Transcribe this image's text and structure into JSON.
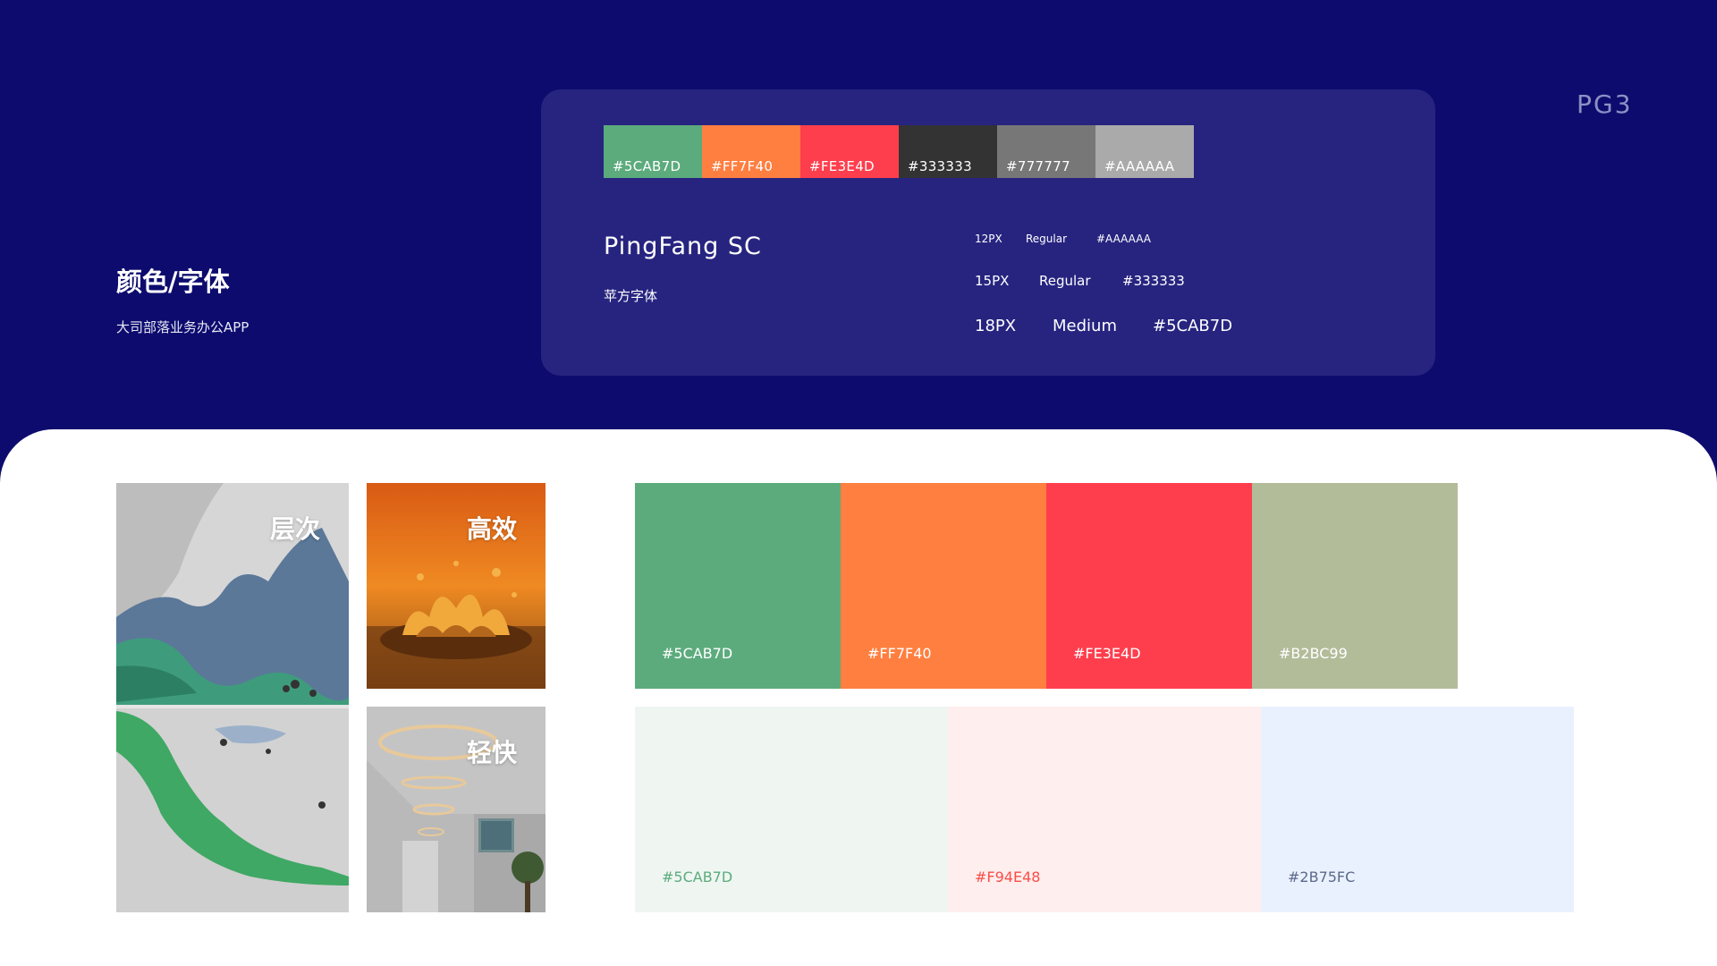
{
  "page_tag": "PG3",
  "left": {
    "title": "颜色/字体",
    "subtitle": "大司部落业务办公APP"
  },
  "strip": [
    {
      "label": "#5CAB7D",
      "color": "#5CAB7D"
    },
    {
      "label": "#FF7F40",
      "color": "#FF7F40"
    },
    {
      "label": "#FE3E4D",
      "color": "#FE3E4D"
    },
    {
      "label": "#333333",
      "color": "#333333"
    },
    {
      "label": "#777777",
      "color": "#777777"
    },
    {
      "label": "#AAAAAA",
      "color": "#AAAAAA"
    }
  ],
  "font": {
    "name": "PingFang SC",
    "name_cn": "苹方字体"
  },
  "type_specs": [
    {
      "size": "12PX",
      "weight": "Regular",
      "color": "#AAAAAA"
    },
    {
      "size": "15PX",
      "weight": "Regular",
      "color": "#333333"
    },
    {
      "size": "18PX",
      "weight": "Medium",
      "color": "#5CAB7D"
    }
  ],
  "images": {
    "layers_label": "层次",
    "efficient_label": "高效",
    "light_label": "轻快"
  },
  "palette": [
    {
      "label": "#5CAB7D",
      "color": "#5CAB7D"
    },
    {
      "label": "#FF7F40",
      "color": "#FF7F40"
    },
    {
      "label": "#FE3E4D",
      "color": "#FE3E4D"
    },
    {
      "label": "#B2BC99",
      "color": "#B2BC99"
    }
  ],
  "tints": [
    {
      "label": "#5CAB7D",
      "bg": "#EFF6F1",
      "text_color": "#5CAB7D"
    },
    {
      "label": "#F94E48",
      "bg": "#FEEEEE",
      "text_color": "#F94E48"
    },
    {
      "label": "#2B75FC",
      "bg": "#EAF1FE",
      "text_color": "#5a6a8a"
    }
  ]
}
